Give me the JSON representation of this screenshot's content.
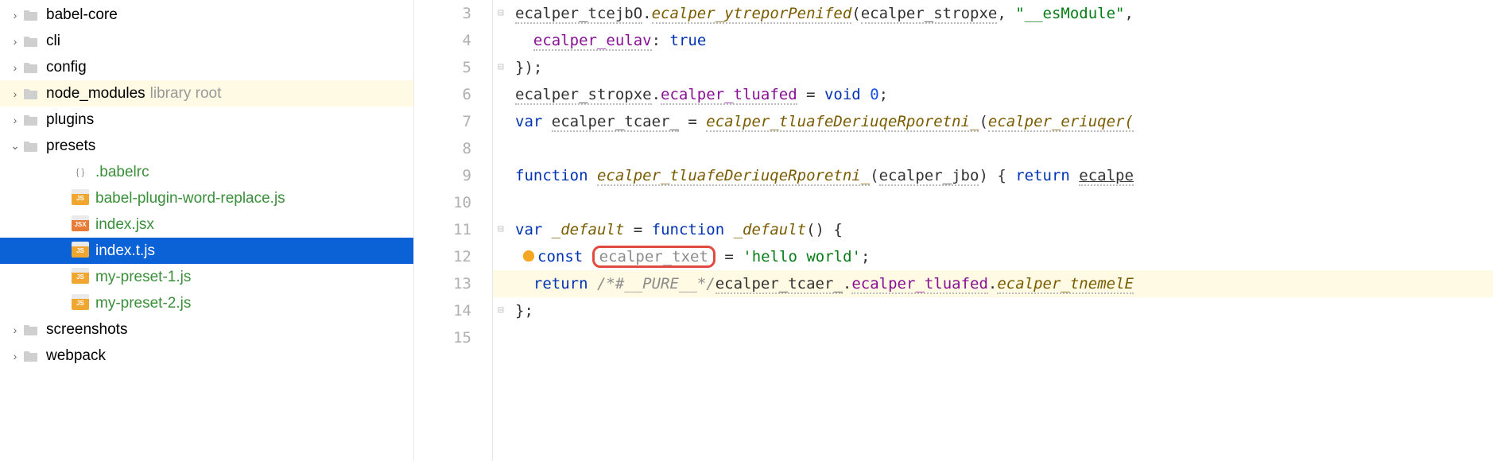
{
  "sidebar": {
    "items": [
      {
        "type": "folder",
        "label": "babel-core",
        "open": false,
        "indent": 0,
        "green": false
      },
      {
        "type": "folder",
        "label": "cli",
        "open": false,
        "indent": 0,
        "green": false
      },
      {
        "type": "folder",
        "label": "config",
        "open": false,
        "indent": 0,
        "green": false
      },
      {
        "type": "folder",
        "label": "node_modules",
        "hint": "library root",
        "open": false,
        "indent": 0,
        "green": false,
        "highlight": true
      },
      {
        "type": "folder",
        "label": "plugins",
        "open": false,
        "indent": 0,
        "green": false
      },
      {
        "type": "folder",
        "label": "presets",
        "open": true,
        "indent": 0,
        "green": false
      },
      {
        "type": "babelrc",
        "label": ".babelrc",
        "indent": 2,
        "green": true
      },
      {
        "type": "js",
        "label": "babel-plugin-word-replace.js",
        "indent": 2,
        "green": true
      },
      {
        "type": "jsx",
        "label": "index.jsx",
        "indent": 2,
        "green": true
      },
      {
        "type": "js",
        "label": "index.t.js",
        "indent": 2,
        "green": false,
        "selected": true
      },
      {
        "type": "js",
        "label": "my-preset-1.js",
        "indent": 2,
        "green": true
      },
      {
        "type": "js",
        "label": "my-preset-2.js",
        "indent": 2,
        "green": true
      },
      {
        "type": "folder",
        "label": "screenshots",
        "open": false,
        "indent": 0,
        "green": false
      },
      {
        "type": "folder",
        "label": "webpack",
        "open": false,
        "indent": 0,
        "green": false
      }
    ]
  },
  "code": {
    "lines": [
      {
        "n": 3
      },
      {
        "n": 4
      },
      {
        "n": 5
      },
      {
        "n": 6
      },
      {
        "n": 7
      },
      {
        "n": 8
      },
      {
        "n": 9
      },
      {
        "n": 10
      },
      {
        "n": 11
      },
      {
        "n": 12
      },
      {
        "n": 13
      },
      {
        "n": 14
      },
      {
        "n": 15
      }
    ],
    "l3": {
      "obj": "ecalper_tcejbO",
      "dot": ".",
      "method": "ecalper_ytreporPenifed",
      "open": "(",
      "arg1": "ecalper_stropxe",
      "comma": ", ",
      "str": "\"__esModule\"",
      "tail": ","
    },
    "l4": {
      "prop": "ecalper_eulav",
      "colon": ": ",
      "val": "true"
    },
    "l5": {
      "text": "});"
    },
    "l6": {
      "a": "ecalper_stropxe",
      "b": ".",
      "c": "ecalper_tluafed",
      "d": " = ",
      "e": "void",
      "f": " ",
      "g": "0",
      "h": ";"
    },
    "l7": {
      "kw": "var",
      "sp": " ",
      "name": "ecalper_tcaer_",
      "eq": " = ",
      "fn": "ecalper_tluafeDeriuqeRporetni_",
      "open": "(",
      "arg": "ecalper_eriuqer(",
      "tail": ""
    },
    "l9": {
      "kw": "function",
      "sp": " ",
      "fn": "ecalper_tluafeDeriuqeRporetni_",
      "open": "(",
      "arg": "ecalper_jbo",
      "mid": ") { ",
      "ret": "return",
      "sp2": " ",
      "tail": "ecalpe"
    },
    "l11": {
      "kw": "var",
      "sp": " ",
      "name": "_default",
      "eq": " = ",
      "kw2": "function",
      "sp2": " ",
      "fn": "_default",
      "tail": "() {"
    },
    "l12": {
      "kw": "const",
      "boxed": "ecalper_txet",
      "eq": " = ",
      "str": "'hello world'",
      "tail": ";"
    },
    "l13": {
      "kw": "return",
      "sp": " ",
      "cm": "/*#__PURE__*/",
      "a": "ecalper_tcaer_",
      "b": ".",
      "c": "ecalper_tluafed",
      "d": ".",
      "e": "ecalper_tnemelE"
    },
    "l14": {
      "text": "};"
    }
  },
  "chart_data": null
}
